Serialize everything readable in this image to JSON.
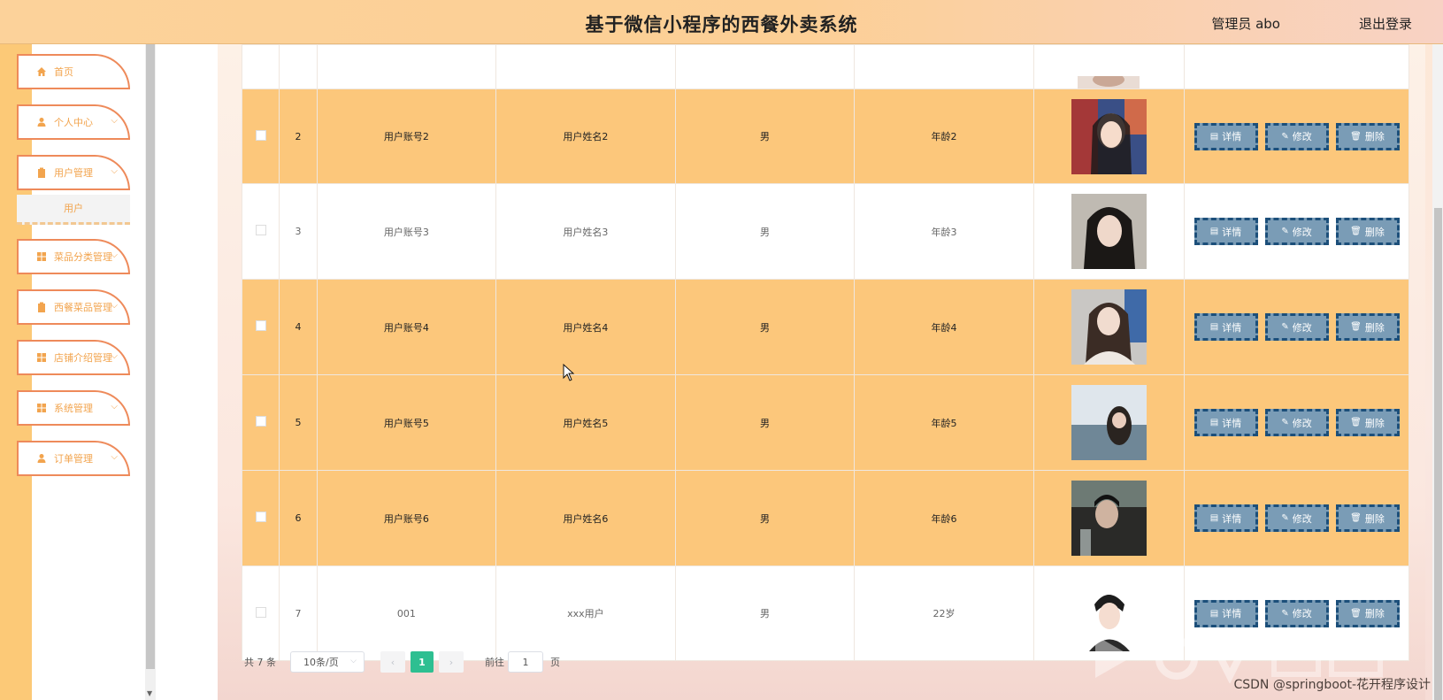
{
  "header": {
    "title": "基于微信小程序的西餐外卖系统",
    "admin": "管理员 abo",
    "logout": "退出登录"
  },
  "sidebar": {
    "items": [
      {
        "label": "首页",
        "icon": "home-icon",
        "chev": ""
      },
      {
        "label": "个人中心",
        "icon": "user-icon",
        "chev": "⌵"
      },
      {
        "label": "用户管理",
        "icon": "clipboard-icon",
        "chev": "⌵"
      },
      {
        "label": "菜品分类管理",
        "icon": "grid-icon",
        "chev": "⌵"
      },
      {
        "label": "西餐菜品管理",
        "icon": "clipboard-icon",
        "chev": "⌵"
      },
      {
        "label": "店铺介绍管理",
        "icon": "grid-icon",
        "chev": "⌵"
      },
      {
        "label": "系统管理",
        "icon": "grid-icon",
        "chev": "⌵"
      },
      {
        "label": "订单管理",
        "icon": "user-icon",
        "chev": "⌵"
      }
    ],
    "sub_item": "用户"
  },
  "table": {
    "rows": [
      {
        "idx": "2",
        "account": "用户账号2",
        "name": "用户姓名2",
        "gender": "男",
        "age": "年龄2"
      },
      {
        "idx": "3",
        "account": "用户账号3",
        "name": "用户姓名3",
        "gender": "男",
        "age": "年龄3"
      },
      {
        "idx": "4",
        "account": "用户账号4",
        "name": "用户姓名4",
        "gender": "男",
        "age": "年龄4"
      },
      {
        "idx": "5",
        "account": "用户账号5",
        "name": "用户姓名5",
        "gender": "男",
        "age": "年龄5"
      },
      {
        "idx": "6",
        "account": "用户账号6",
        "name": "用户姓名6",
        "gender": "男",
        "age": "年龄6"
      },
      {
        "idx": "7",
        "account": "001",
        "name": "xxx用户",
        "gender": "男",
        "age": "22岁"
      }
    ],
    "actions": {
      "detail": "详情",
      "edit": "修改",
      "delete": "删除"
    }
  },
  "pagination": {
    "total": "共 7 条",
    "page_size": "10条/页",
    "current_page": "1",
    "goto_label": "前往",
    "goto_value": "1",
    "page_suffix": "页"
  },
  "watermark": {
    "text": "CSDN @springboot-花开程序设计"
  },
  "colors": {
    "accent": "#fcc77b",
    "active_page": "#2ebf91",
    "action_button": "#7a9cb6"
  }
}
